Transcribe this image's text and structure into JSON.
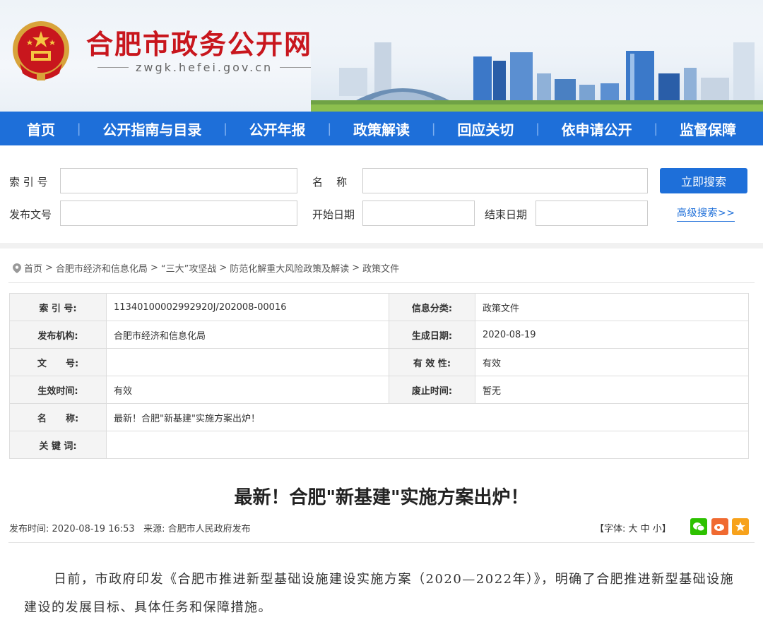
{
  "header": {
    "site_title": "合肥市政务公开网",
    "site_url": "zwgk.hefei.gov.cn",
    "emblem_icon": "national-emblem-icon"
  },
  "nav": {
    "items": [
      "首页",
      "公开指南与目录",
      "公开年报",
      "政策解读",
      "回应关切",
      "依申请公开",
      "监督保障"
    ]
  },
  "search": {
    "index_label": "索 引 号",
    "name_label": "名    称",
    "doc_no_label": "发布文号",
    "start_date_label": "开始日期",
    "end_date_label": "结束日期",
    "search_button": "立即搜索",
    "advanced_link": "高级搜索>>",
    "index_value": "",
    "name_value": "",
    "doc_no_value": "",
    "start_date_value": "",
    "end_date_value": ""
  },
  "breadcrumb": [
    "首页",
    "合肥市经济和信息化局",
    "“三大”攻坚战",
    "防范化解重大风险政策及解读",
    "政策文件"
  ],
  "breadcrumb_sep": ">",
  "info": {
    "index_no_label": "索 引 号:",
    "index_no": "11340100002992920J/202008-00016",
    "category_label": "信息分类:",
    "category": "政策文件",
    "publisher_label": "发布机构:",
    "publisher": "合肥市经济和信息化局",
    "created_label": "生成日期:",
    "created": "2020-08-19",
    "doc_no_label": "文      号:",
    "doc_no": "",
    "validity_label": "有 效 性:",
    "validity": "有效",
    "effective_label": "生效时间:",
    "effective": "有效",
    "repeal_label": "废止时间:",
    "repeal": "暂无",
    "name_label": "名      称:",
    "name": "最新！合肥\"新基建\"实施方案出炉！",
    "keywords_label": "关 键 词:",
    "keywords": ""
  },
  "article": {
    "title": "最新！合肥\"新基建\"实施方案出炉！",
    "publish_time_label": "发布时间:",
    "publish_time": "2020-08-19 16:53",
    "source_label": "来源:",
    "source": "合肥市人民政府发布",
    "font_size_text": "【字体: 大  中  小】",
    "share_icons": [
      "wechat-icon",
      "weibo-icon",
      "favorite-icon"
    ],
    "paragraph": "日前，市政府印发《合肥市推进新型基础设施建设实施方案（2020—2022年）》，明确了合肥推进新型基础设施建设的发展目标、具体任务和保障措施。"
  },
  "colors": {
    "brand_red": "#c8161d",
    "nav_blue": "#1e6fd9",
    "wechat_green": "#2dc100",
    "weibo_orange": "#f06a31",
    "favorite_orange": "#f7a21b"
  }
}
